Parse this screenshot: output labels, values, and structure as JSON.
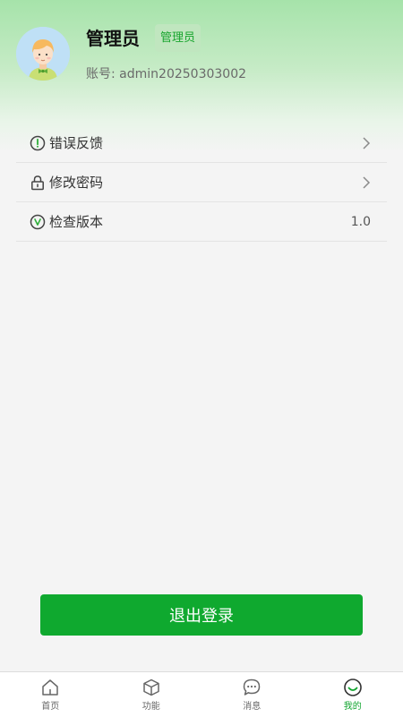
{
  "profile": {
    "name": "管理员",
    "role_badge": "管理员",
    "account_line": "账号: admin20250303002"
  },
  "menu": {
    "items": [
      {
        "label": "错误反馈",
        "icon": "exclamation-circle-icon",
        "right": "chevron-right-icon"
      },
      {
        "label": "修改密码",
        "icon": "lock-icon",
        "right": "chevron-right-icon"
      },
      {
        "label": "检查版本",
        "icon": "v-circle-icon",
        "value": "1.0"
      }
    ]
  },
  "logout": {
    "label": "退出登录"
  },
  "tabbar": {
    "tabs": [
      {
        "label": "首页",
        "icon": "home-icon",
        "active": false
      },
      {
        "label": "功能",
        "icon": "cube-icon",
        "active": false
      },
      {
        "label": "消息",
        "icon": "message-icon",
        "active": false
      },
      {
        "label": "我的",
        "icon": "smile-icon",
        "active": true
      }
    ]
  },
  "colors": {
    "accent": "#0fa92f",
    "header_gradient_top": "#a6e3aa",
    "page_background": "#f4f4f4",
    "badge_background": "#c0e6bf",
    "badge_text": "#19a52e"
  }
}
